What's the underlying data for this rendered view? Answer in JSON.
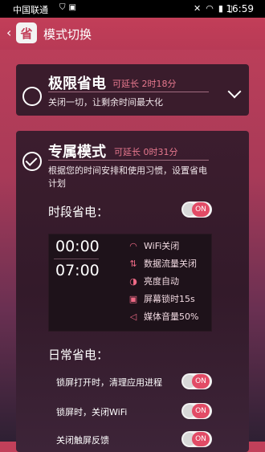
{
  "status_bar": {
    "carrier": "中国联通",
    "time": "16:59",
    "left_icons": [
      "usb-icon",
      "image-icon"
    ],
    "right_icons": [
      "mute-icon",
      "wifi-icon",
      "signal-icon",
      "battery-icon"
    ]
  },
  "header": {
    "back_icon": "chevron-left-icon",
    "app_icon_text": "省",
    "title": "模式切换"
  },
  "modes": [
    {
      "title": "极限省电",
      "extend": "可延长 2时18分",
      "description": "关闭一切，让剩余时间最大化",
      "selected": false
    },
    {
      "title": "专属模式",
      "extend": "可延长 0时31分",
      "description": "根据您的时间安排和使用习惯，设置省电计划",
      "selected": true,
      "schedule_section": {
        "label": "时段省电：",
        "toggle_label": "ON",
        "toggle_on": true,
        "start_time": "00:00",
        "end_time": "07:00",
        "features": [
          {
            "icon": "wifi-icon",
            "label": "WiFi关闭"
          },
          {
            "icon": "data-icon",
            "label": "数据流量关闭"
          },
          {
            "icon": "brightness-icon",
            "label": "亮度自动"
          },
          {
            "icon": "lock-icon",
            "label": "屏幕锁时15s"
          },
          {
            "icon": "volume-icon",
            "label": "媒体音量50%"
          }
        ]
      },
      "daily_section": {
        "label": "日常省电：",
        "items": [
          {
            "label": "锁屏打开时，清理应用进程",
            "toggle_label": "ON",
            "on": true
          },
          {
            "label": "锁屏时，关闭WiFi",
            "toggle_label": "ON",
            "on": true
          },
          {
            "label": "关闭触屏反馈",
            "toggle_label": "ON",
            "on": true
          }
        ]
      }
    }
  ],
  "colors": {
    "accent": "#e24b66",
    "header": "#c23e58",
    "card": "#3a1c2c"
  }
}
